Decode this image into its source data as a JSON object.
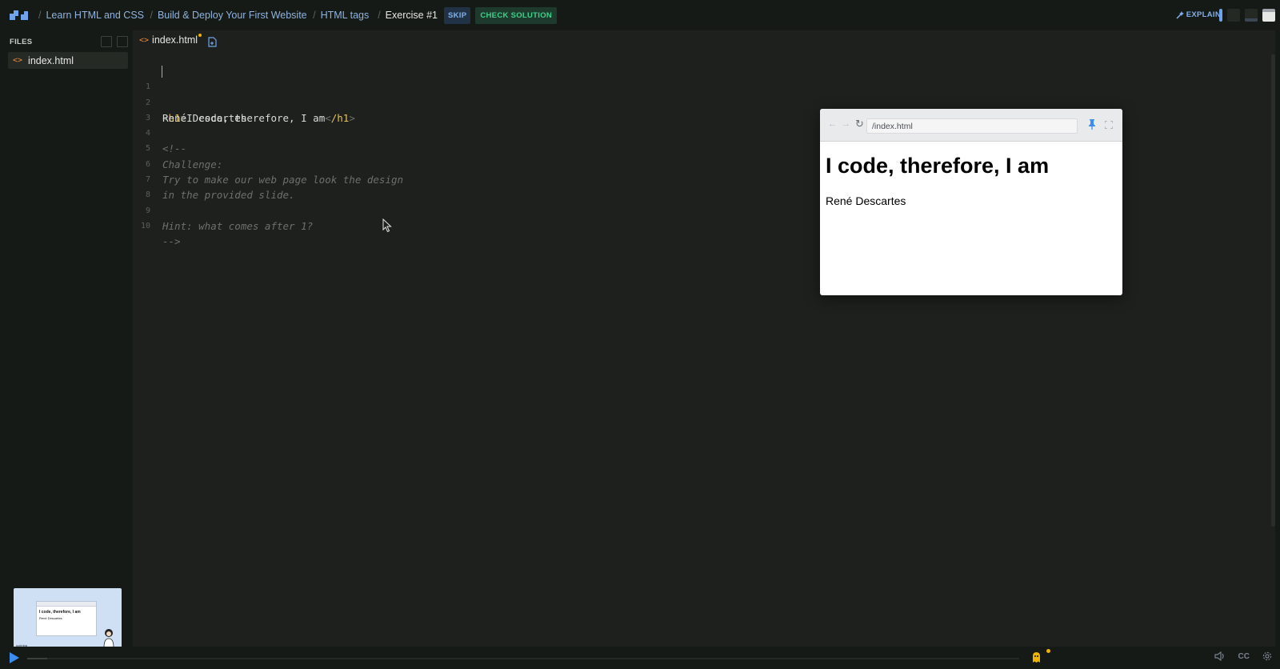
{
  "breadcrumbs": [
    {
      "label": "Learn HTML and CSS"
    },
    {
      "label": "Build & Deploy Your First Website"
    },
    {
      "label": "HTML tags"
    },
    {
      "label": "Exercise #1"
    }
  ],
  "header": {
    "skip_label": "SKIP",
    "check_label": "CHECK SOLUTION",
    "explain_label": "EXPLAIN"
  },
  "sidebar": {
    "files_header": "FILES",
    "files": [
      {
        "name": "index.html",
        "icon": "code-icon"
      }
    ],
    "thumbnail": {
      "heading": "I code, therefore, I am",
      "text": "René Descartes",
      "brand": "scrimba"
    }
  },
  "editor": {
    "tab_label": "index.html",
    "tab_modified": true,
    "lines": [
      {
        "n": "1",
        "tag_open": "h1",
        "text": "I code, therefore, I am",
        "tag_close": "/h1"
      },
      {
        "n": "2",
        "text": "René Descartes"
      },
      {
        "n": "3",
        "text": ""
      },
      {
        "n": "4",
        "comment": "<!--"
      },
      {
        "n": "5",
        "comment": "Challenge:"
      },
      {
        "n": "6",
        "comment": "Try to make our web page look the design"
      },
      {
        "n": "7",
        "comment": "in the provided slide."
      },
      {
        "n": "8",
        "text": ""
      },
      {
        "n": "9",
        "comment": "Hint: what comes after 1?"
      },
      {
        "n": "10",
        "comment": "-->"
      }
    ]
  },
  "preview": {
    "url": "/index.html",
    "heading": "I code, therefore, I am",
    "paragraph": "René Descartes"
  },
  "player": {
    "progress": 0.02,
    "cc_label": "CC"
  },
  "colors": {
    "accent_blue": "#3c8df0",
    "check_green": "#3fd18a",
    "tag_yellow": "#e8c15a",
    "file_orange": "#f08a3c"
  }
}
